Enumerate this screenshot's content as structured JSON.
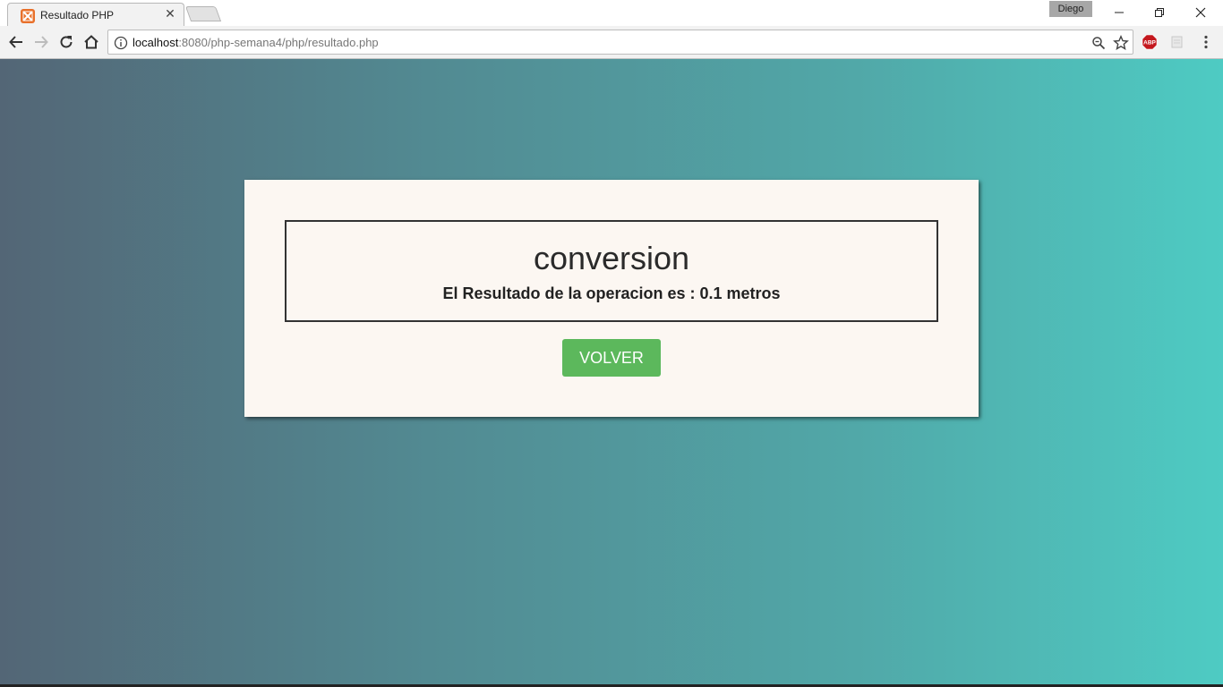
{
  "browser": {
    "tab": {
      "title": "Resultado PHP",
      "close_glyph": "✕"
    },
    "profile_name": "Diego",
    "url": {
      "host": "localhost",
      "rest": ":8080/php-semana4/php/resultado.php"
    },
    "icons": {
      "favicon": "xampp-icon",
      "back": "arrow-left-icon",
      "forward": "arrow-right-icon",
      "reload": "reload-icon",
      "home": "home-icon",
      "info": "info-icon",
      "zoom": "zoom-icon",
      "bookmark": "star-icon",
      "adblock": "abp-icon",
      "menu": "kebab-menu-icon"
    },
    "abp_label": "ABP"
  },
  "page": {
    "title": "conversion",
    "result_text": "El Resultado de la operacion es : 0.1 metros",
    "button_label": "VOLVER",
    "colors": {
      "gradient_start": "#536676",
      "gradient_end": "#4ecbc3",
      "card_bg": "#fcf7f2",
      "button_bg": "#5cb85c"
    }
  }
}
